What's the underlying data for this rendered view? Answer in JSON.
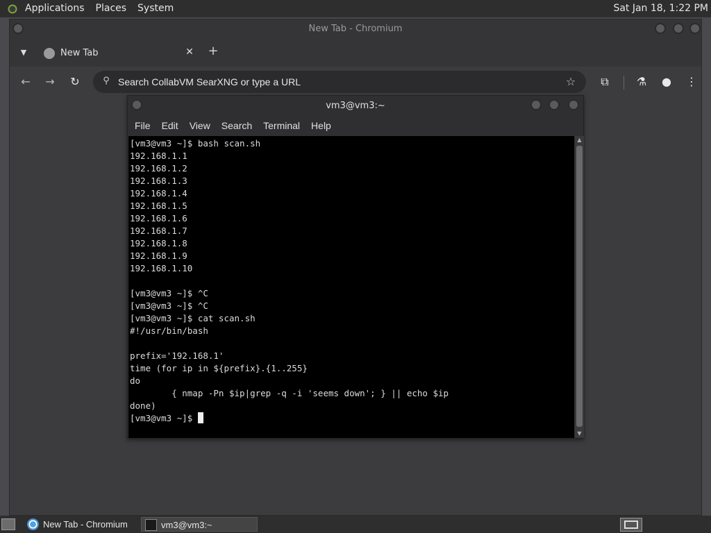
{
  "top_panel": {
    "menus": [
      "Applications",
      "Places",
      "System"
    ],
    "clock": "Sat Jan 18,  1:22 PM"
  },
  "chromium": {
    "window_title": "New Tab - Chromium",
    "tab": {
      "title": "New Tab",
      "close_glyph": "✕"
    },
    "new_tab_glyph": "+",
    "omnibox": {
      "placeholder": "Search CollabVM SearXNG or type a URL"
    },
    "icons": [
      "back-icon",
      "forward-icon",
      "reload-icon",
      "search-icon",
      "star-icon",
      "extensions-icon",
      "labs-icon",
      "profile-icon",
      "menu-icon"
    ]
  },
  "terminal": {
    "window_title": "vm3@vm3:~",
    "menu": [
      "File",
      "Edit",
      "View",
      "Search",
      "Terminal",
      "Help"
    ],
    "lines": [
      "[vm3@vm3 ~]$ bash scan.sh",
      "192.168.1.1",
      "192.168.1.2",
      "192.168.1.3",
      "192.168.1.4",
      "192.168.1.5",
      "192.168.1.6",
      "192.168.1.7",
      "192.168.1.8",
      "192.168.1.9",
      "192.168.1.10",
      "",
      "[vm3@vm3 ~]$ ^C",
      "[vm3@vm3 ~]$ ^C",
      "[vm3@vm3 ~]$ cat scan.sh",
      "#!/usr/bin/bash",
      "",
      "prefix='192.168.1'",
      "time (for ip in ${prefix}.{1..255}",
      "do",
      "        { nmap -Pn $ip|grep -q -i 'seems down'; } || echo $ip",
      "done)"
    ],
    "prompt": "[vm3@vm3 ~]$ "
  },
  "taskbar": {
    "tasks": [
      {
        "label": "New Tab - Chromium"
      },
      {
        "label": "vm3@vm3:~"
      }
    ]
  }
}
